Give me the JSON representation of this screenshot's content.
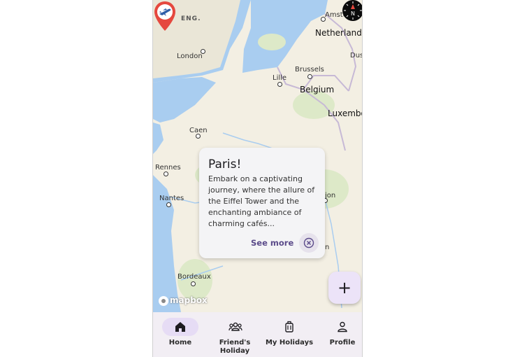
{
  "map": {
    "labels": {
      "eng": "ENG.",
      "amsterdam": "Amste",
      "netherlands": "Netherlands",
      "london": "London",
      "dus": "Dus",
      "brussels": "Brussels",
      "lille": "Lille",
      "belgium": "Belgium",
      "luxembourg": "Luxembo",
      "caen": "Caen",
      "rennes": "Rennes",
      "nantes": "Nantes",
      "dijon": "jon",
      "n": "n",
      "bordeaux": "Bordeaux"
    },
    "attribution": "mapbox",
    "colors": {
      "water": "#a9cdf0",
      "land": "#f3efe3",
      "forest": "#d6e7c3",
      "border": "#c7b9d6"
    }
  },
  "popup": {
    "title": "Paris!",
    "description": "Embark on  a captivating journey, where the allure of the Eiffel Tower and the enchanting ambiance of charming cafés...",
    "see_more": "See more"
  },
  "pin": {
    "icon": "airplane-icon",
    "color": "#e5483e"
  },
  "fab": {
    "label": "+"
  },
  "nav": {
    "items": [
      {
        "label": "Home",
        "icon": "home-icon",
        "active": true
      },
      {
        "label": "Friend's Holiday",
        "icon": "group-icon",
        "active": false
      },
      {
        "label": "My Holidays",
        "icon": "luggage-icon",
        "active": false
      },
      {
        "label": "Profile",
        "icon": "person-icon",
        "active": false
      }
    ]
  },
  "accent_color": "#5b4b8a"
}
